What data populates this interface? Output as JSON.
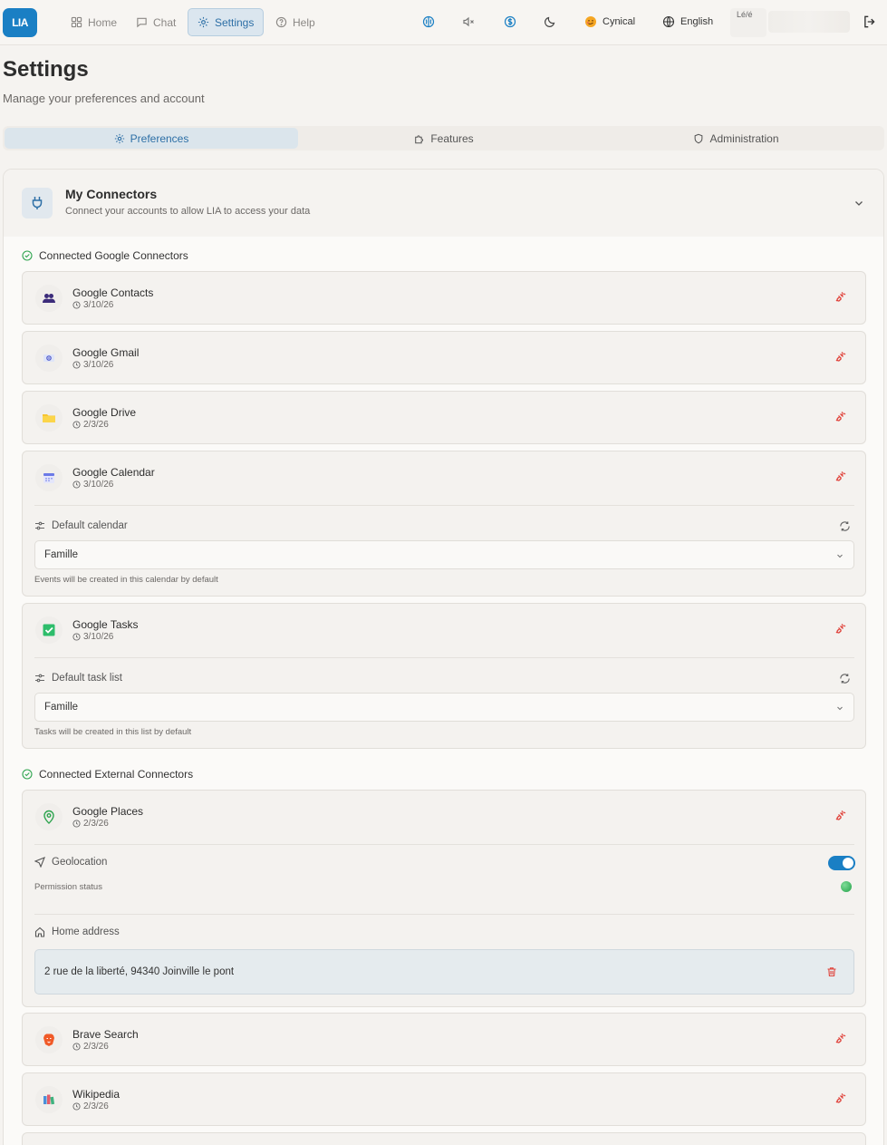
{
  "app": {
    "logo": "LIA"
  },
  "nav": {
    "home": "Home",
    "chat": "Chat",
    "settings": "Settings",
    "help": "Help"
  },
  "toolbar": {
    "personality": "Cynical",
    "language": "English",
    "avatar_alt": "Lé/é"
  },
  "page": {
    "title": "Settings",
    "subtitle": "Manage your preferences and account"
  },
  "tabs": {
    "preferences": "Preferences",
    "features": "Features",
    "administration": "Administration"
  },
  "connectors": {
    "title": "My Connectors",
    "subtitle": "Connect your accounts to allow LIA to access your data",
    "google_section": "Connected Google Connectors",
    "external_section": "Connected External Connectors",
    "google": [
      {
        "name": "Google Contacts",
        "date": "3/10/26"
      },
      {
        "name": "Google Gmail",
        "date": "3/10/26"
      },
      {
        "name": "Google Drive",
        "date": "2/3/26"
      },
      {
        "name": "Google Calendar",
        "date": "3/10/26"
      },
      {
        "name": "Google Tasks",
        "date": "3/10/26"
      }
    ],
    "calendar_settings": {
      "label": "Default calendar",
      "value": "Famille",
      "hint": "Events will be created in this calendar by default"
    },
    "tasks_settings": {
      "label": "Default task list",
      "value": "Famille",
      "hint": "Tasks will be created in this list by default"
    },
    "external": [
      {
        "name": "Google Places",
        "date": "2/3/26"
      },
      {
        "name": "Brave Search",
        "date": "2/3/26"
      },
      {
        "name": "Wikipedia",
        "date": "2/3/26"
      }
    ],
    "places_settings": {
      "geolocation_label": "Geolocation",
      "geolocation_enabled": true,
      "permission_label": "Permission status",
      "permission_color": "#25a24a",
      "home_label": "Home address",
      "home_value": "2 rue de la liberté, 94340 Joinville le pont"
    }
  },
  "colors": {
    "accent": "#1a7fc4",
    "danger": "#e0443c",
    "success": "#2ea44f"
  }
}
